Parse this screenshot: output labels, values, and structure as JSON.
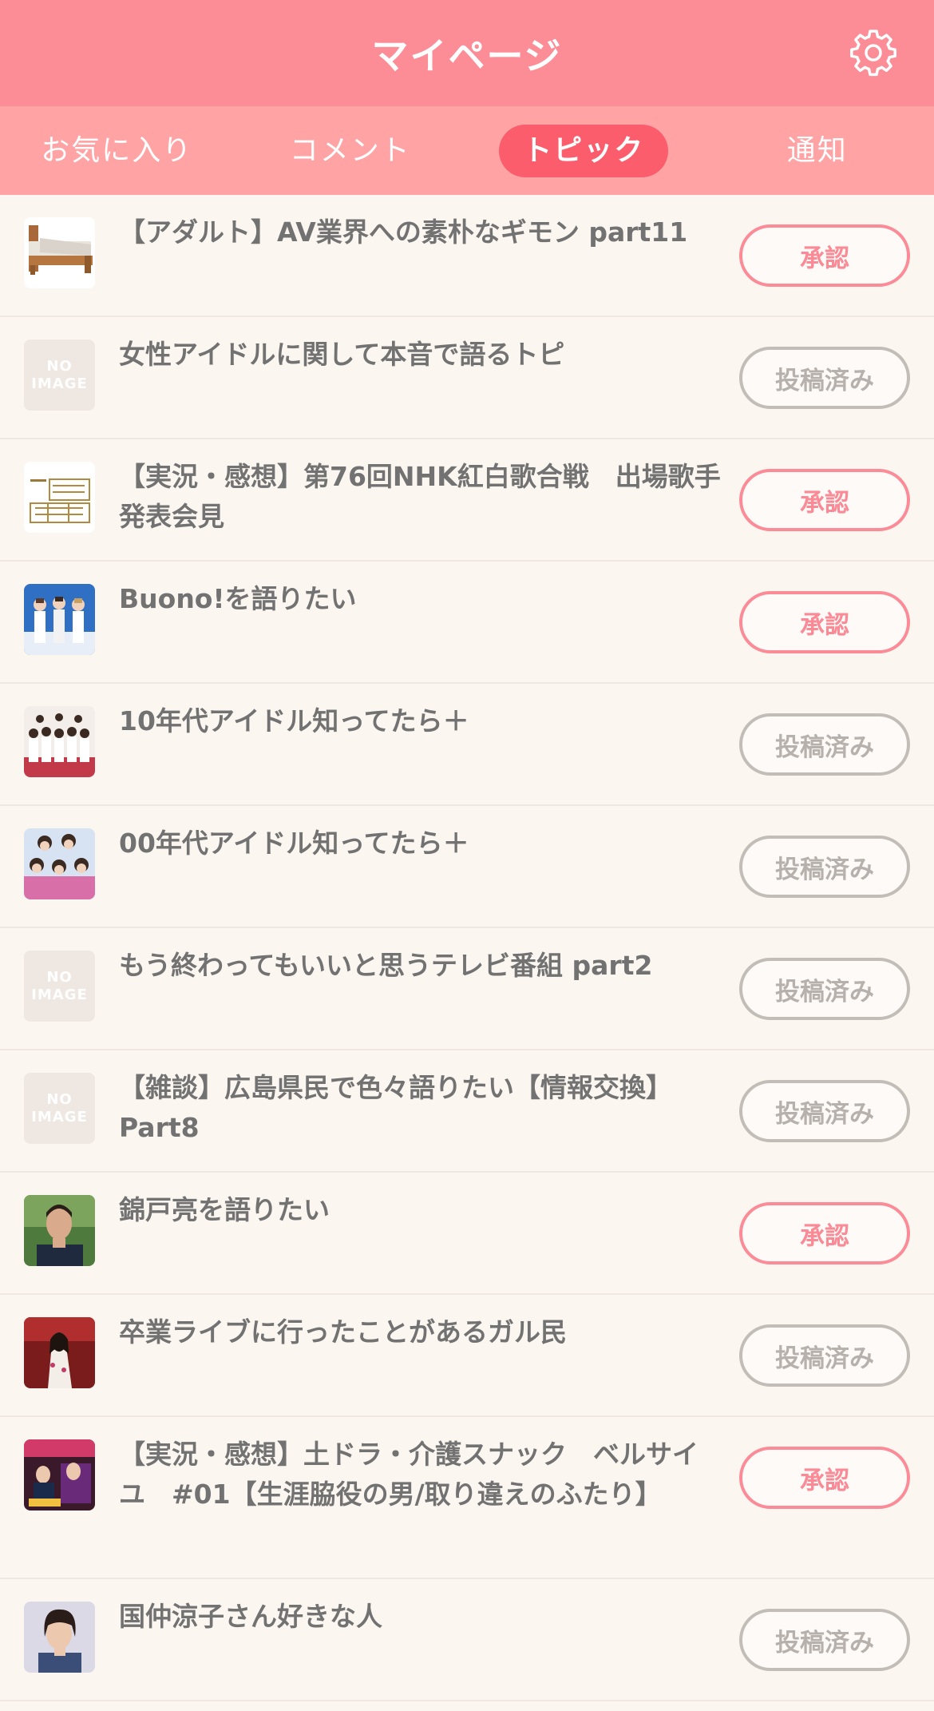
{
  "header": {
    "title": "マイページ",
    "settings_icon": "gear-icon"
  },
  "tabs": [
    {
      "label": "お気に入り",
      "active": false
    },
    {
      "label": "コメント",
      "active": false
    },
    {
      "label": "トピック",
      "active": true
    },
    {
      "label": "通知",
      "active": false
    }
  ],
  "no_image": {
    "line1": "NO",
    "line2": "IMAGE"
  },
  "topics": [
    {
      "title": "【アダルト】AV業界への素朴なギモン part11",
      "status": "承認",
      "type": "approve",
      "thumb": "bed"
    },
    {
      "title": "女性アイドルに関して本音で語るトピ",
      "status": "投稿済み",
      "type": "posted",
      "thumb": "noimage"
    },
    {
      "title": "【実況・感想】第76回NHK紅白歌合戦　出場歌手発表会見",
      "status": "承認",
      "type": "approve",
      "thumb": "kouhaku"
    },
    {
      "title": "Buono!を語りたい",
      "status": "承認",
      "type": "approve",
      "thumb": "group-blue"
    },
    {
      "title": "10年代アイドル知ってたら＋",
      "status": "投稿済み",
      "type": "posted",
      "thumb": "group-white"
    },
    {
      "title": "00年代アイドル知ってたら＋",
      "status": "投稿済み",
      "type": "posted",
      "thumb": "group-pink"
    },
    {
      "title": "もう終わってもいいと思うテレビ番組 part2",
      "status": "投稿済み",
      "type": "posted",
      "thumb": "noimage"
    },
    {
      "title": "【雑談】広島県民で色々語りたい【情報交換】Part8",
      "status": "投稿済み",
      "type": "posted",
      "thumb": "noimage"
    },
    {
      "title": "錦戸亮を語りたい",
      "status": "承認",
      "type": "approve",
      "thumb": "man-portrait"
    },
    {
      "title": "卒業ライブに行ったことがあるガル民",
      "status": "投稿済み",
      "type": "posted",
      "thumb": "stage-red"
    },
    {
      "title": "【実況・感想】土ドラ・介護スナック　ベルサイユ　#01【生涯脇役の男/取り違えのふたり】",
      "status": "承認",
      "type": "approve",
      "thumb": "drama"
    },
    {
      "title": "国仲涼子さん好きな人",
      "status": "投稿済み",
      "type": "posted",
      "thumb": "woman-portrait"
    }
  ],
  "colors": {
    "header": "#fc8c95",
    "tabs": "#ffa3a5",
    "active_tab": "#fb5d6d",
    "approve": "#fa8a96",
    "posted": "#b7b1ad"
  }
}
